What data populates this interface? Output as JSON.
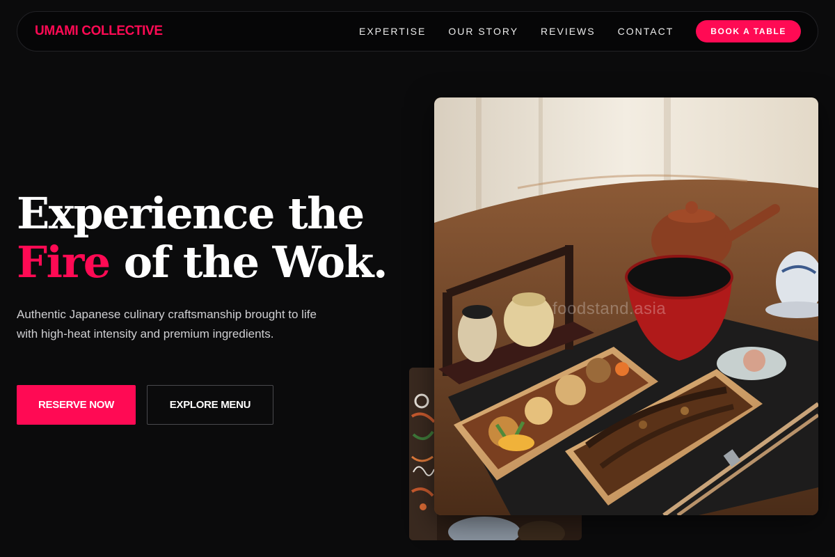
{
  "brand": "UMAMI COLLECTIVE",
  "nav": {
    "links": [
      "EXPERTISE",
      "OUR STORY",
      "REVIEWS",
      "CONTACT"
    ],
    "cta": "BOOK A TABLE"
  },
  "hero": {
    "title_line1": "Experience the",
    "title_accent": "Fire",
    "title_line2_rest": " of the Wok.",
    "description": "Authentic Japanese culinary craftsmanship brought to life with high-heat intensity and premium ingredients.",
    "primary_button": "RESERVE NOW",
    "secondary_button": "EXPLORE MENU"
  },
  "images": {
    "watermark": "foodstand.asia"
  },
  "colors": {
    "accent": "#ff0a54",
    "background": "#0b0b0c",
    "nav_background": "#060607"
  }
}
